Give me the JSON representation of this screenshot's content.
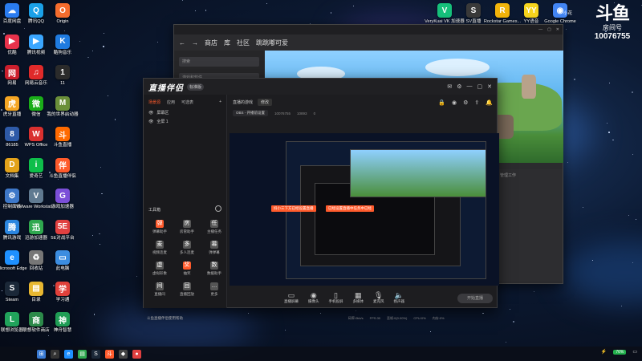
{
  "desktop": {
    "left_icons": [
      {
        "label": "百度网盘",
        "color": "#2a7cf0",
        "glyph": "☁"
      },
      {
        "label": "腾讯QQ",
        "color": "#1aa0e8",
        "glyph": "Q"
      },
      {
        "label": "Origin",
        "color": "#f56c2d",
        "glyph": "O"
      },
      {
        "label": "优酷",
        "color": "#e8324b",
        "glyph": "▶"
      },
      {
        "label": "腾讯视频",
        "color": "#3aa6ff",
        "glyph": "▶"
      },
      {
        "label": "酷狗音乐",
        "color": "#1f7be0",
        "glyph": "K"
      },
      {
        "label": "网易",
        "color": "#cc1f2d",
        "glyph": "网"
      },
      {
        "label": "网易云音乐",
        "color": "#e02a2a",
        "glyph": "♫"
      },
      {
        "label": "11",
        "color": "#2b2b2b",
        "glyph": "1"
      },
      {
        "label": "虎牙直播",
        "color": "#f5a623",
        "glyph": "虎"
      },
      {
        "label": "微信",
        "color": "#1aad19",
        "glyph": "微"
      },
      {
        "label": "我的世界启动器",
        "color": "#6a8f3a",
        "glyph": "M"
      },
      {
        "label": "86185",
        "color": "#2e5aa8",
        "glyph": "8"
      },
      {
        "label": "WPS Office",
        "color": "#d9302f",
        "glyph": "W"
      },
      {
        "label": "斗鱼直播",
        "color": "#ff6a00",
        "glyph": "斗"
      },
      {
        "label": "文档集",
        "color": "#e3a21a",
        "glyph": "D"
      },
      {
        "label": "爱奇艺",
        "color": "#0ebe4a",
        "glyph": "i"
      },
      {
        "label": "斗鱼直播伴侣",
        "color": "#ff5a2b",
        "glyph": "伴"
      },
      {
        "label": "控制面板",
        "color": "#3e78c9",
        "glyph": "⚙"
      },
      {
        "label": "VMware Workstati...",
        "color": "#607a91",
        "glyph": "V"
      },
      {
        "label": "游戏加速器",
        "color": "#7b4fd8",
        "glyph": "G"
      },
      {
        "label": "腾讯游戏",
        "color": "#2b86e0",
        "glyph": "腾"
      },
      {
        "label": "迅游加速器",
        "color": "#2fa84f",
        "glyph": "迅"
      },
      {
        "label": "5E对战平台",
        "color": "#e04040",
        "glyph": "5E"
      },
      {
        "label": "Microsoft Edge",
        "color": "#1e90ff",
        "glyph": "e"
      },
      {
        "label": "回收站",
        "color": "#777",
        "glyph": "♻"
      },
      {
        "label": "此电脑",
        "color": "#3c8de0",
        "glyph": "▭"
      },
      {
        "label": "Steam",
        "color": "#1b2838",
        "glyph": "S"
      },
      {
        "label": "目录",
        "color": "#e7b731",
        "glyph": "▤"
      },
      {
        "label": "学习通",
        "color": "#e0413b",
        "glyph": "学"
      },
      {
        "label": "联想浏览器",
        "color": "#21a35b",
        "glyph": "L"
      },
      {
        "label": "联想软件商店",
        "color": "#2c8a4a",
        "glyph": "商"
      },
      {
        "label": "神舟智慧",
        "color": "#1f9d55",
        "glyph": "神"
      }
    ],
    "top_icons": [
      {
        "label": "VeryKuai VK 加速器",
        "color": "#16c07b",
        "glyph": "V"
      },
      {
        "label": "SV直播",
        "color": "#3a3a3a",
        "glyph": "S"
      },
      {
        "label": "Rockstar Games...",
        "color": "#f3b50b",
        "glyph": "R"
      },
      {
        "label": "YY语音",
        "color": "#f7d51d",
        "glyph": "YY"
      },
      {
        "label": "Google Chrome",
        "color": "#4285f4",
        "glyph": "◉"
      }
    ]
  },
  "douyu_badge": {
    "logo": "斗鱼",
    "room_label": "房间号",
    "room_number": "10076755",
    "user": "小花"
  },
  "back_window": {
    "nav_items": [
      "商店",
      "库",
      "社区",
      "跳跳嘟可爱"
    ],
    "search_placeholder": "搜索",
    "filter_label": "游戏和软件",
    "info_lines": [
      "管理工作",
      "",
      "",
      "",
      "",
      "",
      ""
    ]
  },
  "main_window": {
    "brand": "直播伴侣",
    "version": "标准版",
    "sidebar_tabs": [
      "场景源",
      "应用",
      "可选表"
    ],
    "scenes": [
      "屏幕区",
      "全屏 1"
    ],
    "tools_heading": "工具箱",
    "tools": [
      {
        "label": "弹幕助手",
        "color": "#ff5a2b",
        "glyph": "弹"
      },
      {
        "label": "房管助手",
        "color": "#555",
        "glyph": "房"
      },
      {
        "label": "主播任务",
        "color": "#555",
        "glyph": "任"
      },
      {
        "label": "视频连麦",
        "color": "#555",
        "glyph": "麦"
      },
      {
        "label": "多人连麦",
        "color": "#555",
        "glyph": "多"
      },
      {
        "label": "弹弹幕",
        "color": "#555",
        "glyph": "幕"
      },
      {
        "label": "虚拟形象",
        "color": "#555",
        "glyph": "虚"
      },
      {
        "label": "抽奖",
        "color": "#ff5a2b",
        "glyph": "奖"
      },
      {
        "label": "数据助手",
        "color": "#555",
        "glyph": "数"
      },
      {
        "label": "直播间",
        "color": "#555",
        "glyph": "间"
      },
      {
        "label": "直播回放",
        "color": "#555",
        "glyph": "回"
      },
      {
        "label": "更多",
        "color": "#555",
        "glyph": "…"
      }
    ],
    "notice": "斗鱼直播伴侣使用帮助",
    "header_title": "直播的游戏",
    "header_button": "修改",
    "resolution": "OBS - 开播前设置",
    "room_id": "10076755",
    "viewers": "10893",
    "stats": "0",
    "bottom_controls": [
      {
        "label": "直播屏幕",
        "glyph": "▭"
      },
      {
        "label": "摄像头",
        "glyph": "◉"
      },
      {
        "label": "手机投屏",
        "glyph": "▯"
      },
      {
        "label": "多媒体",
        "glyph": "▦"
      },
      {
        "label": "麦克风",
        "glyph": "🎙"
      },
      {
        "label": "扬声器",
        "glyph": "🔈"
      }
    ],
    "start_button": "开始直播",
    "status_items": [
      "码率:0kb/s",
      "FPS:30",
      "丢帧:0(0.00%)",
      "CPU:0%",
      "内存:0%"
    ],
    "toast1": "抖小三下方已经设置直播",
    "toast2": "已经设置直播中任务中已经"
  },
  "taskbar": {
    "battery": "76%",
    "time": "",
    "date": ""
  }
}
